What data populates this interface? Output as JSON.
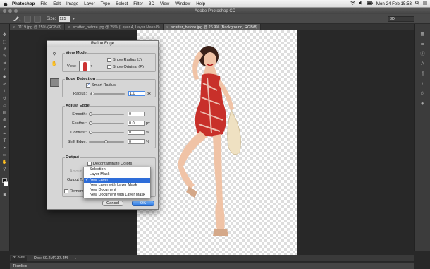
{
  "menubar": {
    "app": "Photoshop",
    "items": [
      "File",
      "Edit",
      "Image",
      "Layer",
      "Type",
      "Select",
      "Filter",
      "3D",
      "View",
      "Window",
      "Help"
    ],
    "clock": "Mon 24 Feb  15:53"
  },
  "window": {
    "title": "Adobe Photoshop CC"
  },
  "options_bar": {
    "size_label": "Size:",
    "size_value": "125",
    "workspace": "3D"
  },
  "tabs": [
    {
      "label": "0119.jpg @ 25% (RGB/8)",
      "active": false
    },
    {
      "label": "scatter_before.jpg @ 25% (Layer 4, Layer Mask/8)",
      "active": false
    },
    {
      "label": "scatter_before.jpg @ 26.9% (Background, RGB/8)",
      "active": true
    }
  ],
  "status": {
    "zoom": "26.89%",
    "doc": "Doc: 60.2M/137.4M"
  },
  "timeline": {
    "label": "Timeline"
  },
  "dialog": {
    "title": "Refine Edge",
    "view_mode": {
      "label": "View Mode",
      "view_label": "View:",
      "show_radius": "Show Radius (J)",
      "show_original": "Show Original (P)"
    },
    "edge_detection": {
      "label": "Edge Detection",
      "smart_radius": "Smart Radius",
      "smart_radius_checked": true,
      "radius_label": "Radius:",
      "radius_value": "1.0",
      "radius_unit": "px"
    },
    "adjust_edge": {
      "label": "Adjust Edge",
      "smooth_label": "Smooth:",
      "smooth_value": "0",
      "feather_label": "Feather:",
      "feather_value": "0.0",
      "feather_unit": "px",
      "contrast_label": "Contrast:",
      "contrast_value": "0",
      "contrast_unit": "%",
      "shift_label": "Shift Edge:",
      "shift_value": "0",
      "shift_unit": "%"
    },
    "output": {
      "label": "Output",
      "decontaminate": "Decontaminate Colors",
      "amount_label": "Amoun",
      "output_to_label": "Output To",
      "remember_label": "Remembe"
    },
    "cancel_label": "Cancel",
    "ok_label": "OK"
  },
  "dropdown": {
    "options": [
      "Selection",
      "Layer Mask",
      "New Layer",
      "New Layer with Layer Mask",
      "New Document",
      "New Document with Layer Mask"
    ],
    "selected_index": 2
  },
  "colors": {
    "accent_blue": "#2d6cd8",
    "dress_red": "#c8302a",
    "canvas_checker": "#dddddd"
  }
}
